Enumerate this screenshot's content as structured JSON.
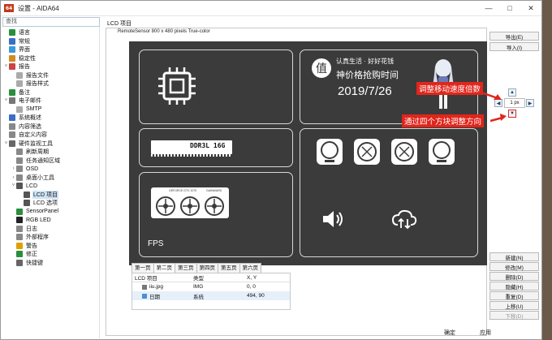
{
  "window": {
    "title": "设置 - AIDA64",
    "app_icon": "64",
    "controls": [
      "minimize-icon",
      "maximize-icon",
      "close-icon"
    ]
  },
  "sidebar": {
    "search_placeholder": "查找",
    "items": [
      {
        "label": "语言",
        "indent": 0,
        "icon": "globe-icon",
        "color": "#2a8f3c"
      },
      {
        "label": "常规",
        "indent": 0,
        "icon": "settings-icon",
        "color": "#3b6fc4"
      },
      {
        "label": "界面",
        "indent": 0,
        "icon": "window-icon",
        "color": "#3b9ad9"
      },
      {
        "label": "稳定性",
        "indent": 0,
        "icon": "stability-icon",
        "color": "#d18b22"
      },
      {
        "label": "报告",
        "indent": 0,
        "icon": "report-icon",
        "color": "#c44",
        "expanded": true
      },
      {
        "label": "报告文件",
        "indent": 1,
        "icon": "file-icon",
        "color": "#aaa"
      },
      {
        "label": "报告样式",
        "indent": 1,
        "icon": "style-icon",
        "color": "#aaa"
      },
      {
        "label": "备注",
        "indent": 0,
        "icon": "note-icon",
        "color": "#2a8f3c"
      },
      {
        "label": "电子邮件",
        "indent": 0,
        "icon": "mail-icon",
        "color": "#777",
        "expanded": true
      },
      {
        "label": "SMTP",
        "indent": 1,
        "icon": "smtp-icon",
        "color": "#aaa"
      },
      {
        "label": "系统概述",
        "indent": 0,
        "icon": "overview-icon",
        "color": "#3b6fc4"
      },
      {
        "label": "内容筛选",
        "indent": 0,
        "icon": "filter-icon",
        "color": "#888"
      },
      {
        "label": "自定义内容",
        "indent": 0,
        "icon": "custom-icon",
        "color": "#888"
      },
      {
        "label": "硬件监视工具",
        "indent": 0,
        "icon": "monitor-icon",
        "color": "#666",
        "expanded": true
      },
      {
        "label": "刷新周期",
        "indent": 1,
        "icon": "refresh-icon",
        "color": "#888"
      },
      {
        "label": "任务通知区域",
        "indent": 1,
        "icon": "tray-icon",
        "color": "#888"
      },
      {
        "label": "OSD",
        "indent": 1,
        "icon": "osd-icon",
        "color": "#888",
        "collapsed": true
      },
      {
        "label": "桌面小工具",
        "indent": 1,
        "icon": "gadget-icon",
        "color": "#888",
        "collapsed": true
      },
      {
        "label": "LCD",
        "indent": 1,
        "icon": "lcd-icon",
        "color": "#555",
        "expanded": true
      },
      {
        "label": "LCD 项目",
        "indent": 2,
        "icon": "lcd-item-icon",
        "color": "#555",
        "selected": true
      },
      {
        "label": "LCD 选项",
        "indent": 2,
        "icon": "lcd-option-icon",
        "color": "#555"
      },
      {
        "label": "SensorPanel",
        "indent": 1,
        "icon": "sensorpanel-icon",
        "color": "#2a8f3c"
      },
      {
        "label": "RGB LED",
        "indent": 1,
        "icon": "rgb-icon",
        "color": "#222"
      },
      {
        "label": "日志",
        "indent": 1,
        "icon": "log-icon",
        "color": "#888"
      },
      {
        "label": "外部程序",
        "indent": 1,
        "icon": "program-icon",
        "color": "#888"
      },
      {
        "label": "警告",
        "indent": 1,
        "icon": "warning-icon",
        "color": "#e0a000"
      },
      {
        "label": "修正",
        "indent": 1,
        "icon": "fix-icon",
        "color": "#2a8f3c"
      },
      {
        "label": "快捷键",
        "indent": 1,
        "icon": "hotkey-icon",
        "color": "#666"
      }
    ]
  },
  "main": {
    "title": "LCD 项目",
    "lcd_description": "RemoteSensor 800 x 480 pixels True-color",
    "lcd": {
      "ram_label": "DDR3L 16G",
      "fps_label": "FPS",
      "date": "2019/7/26",
      "logo_char": "值",
      "slogan_top": "认真生活 · 好好花钱",
      "slogan_bottom": "神价格抢购时间",
      "gpu_brand": "GEFORCE GTX 1070",
      "gpu_vendor": "GAINWARD"
    },
    "tabs": [
      "第一页",
      "第二页",
      "第三页",
      "第四页",
      "第五页",
      "第六页"
    ],
    "active_tab": 1,
    "table": {
      "headers": [
        "LCD 项目",
        "类型",
        "X, Y"
      ],
      "rows": [
        {
          "name": "iiu.jpg",
          "type": "IMG",
          "xy": "0, 0",
          "icon": "image-icon"
        },
        {
          "name": "日期",
          "type": "系统",
          "xy": "494, 90",
          "icon": "system-icon"
        }
      ]
    },
    "buttons_top": [
      "导出(E)",
      "导入(I)"
    ],
    "buttons_bottom": [
      "新建(N)",
      "修改(M)",
      "删除(D)",
      "隐藏(H)",
      "重复(D)",
      "上移(U)",
      "下移(D)"
    ],
    "position_control": {
      "step": "1 px"
    },
    "bottom_right": [
      "确定",
      "应用"
    ]
  },
  "annotations": {
    "speed": "调整移动速度倍数",
    "direction": "通过四个方块调整方向",
    "color": "#e0261c"
  }
}
